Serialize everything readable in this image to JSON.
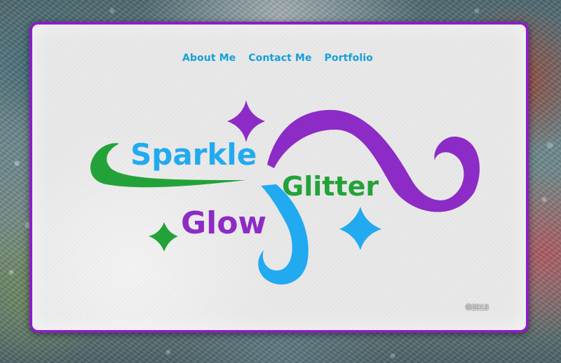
{
  "nav": {
    "items": [
      {
        "label": "About Me"
      },
      {
        "label": "Contact Me"
      },
      {
        "label": "Portfolio"
      }
    ]
  },
  "logo": {
    "word1": "Sparkle",
    "word2": "Glitter",
    "word3": "Glow"
  },
  "footer": {
    "copyright": "©2013"
  },
  "colors": {
    "frame": "#8a1fc6",
    "purple": "#8d2bc6",
    "green": "#24a23a",
    "blue": "#22aaf0",
    "nav": "#14a0d8"
  }
}
